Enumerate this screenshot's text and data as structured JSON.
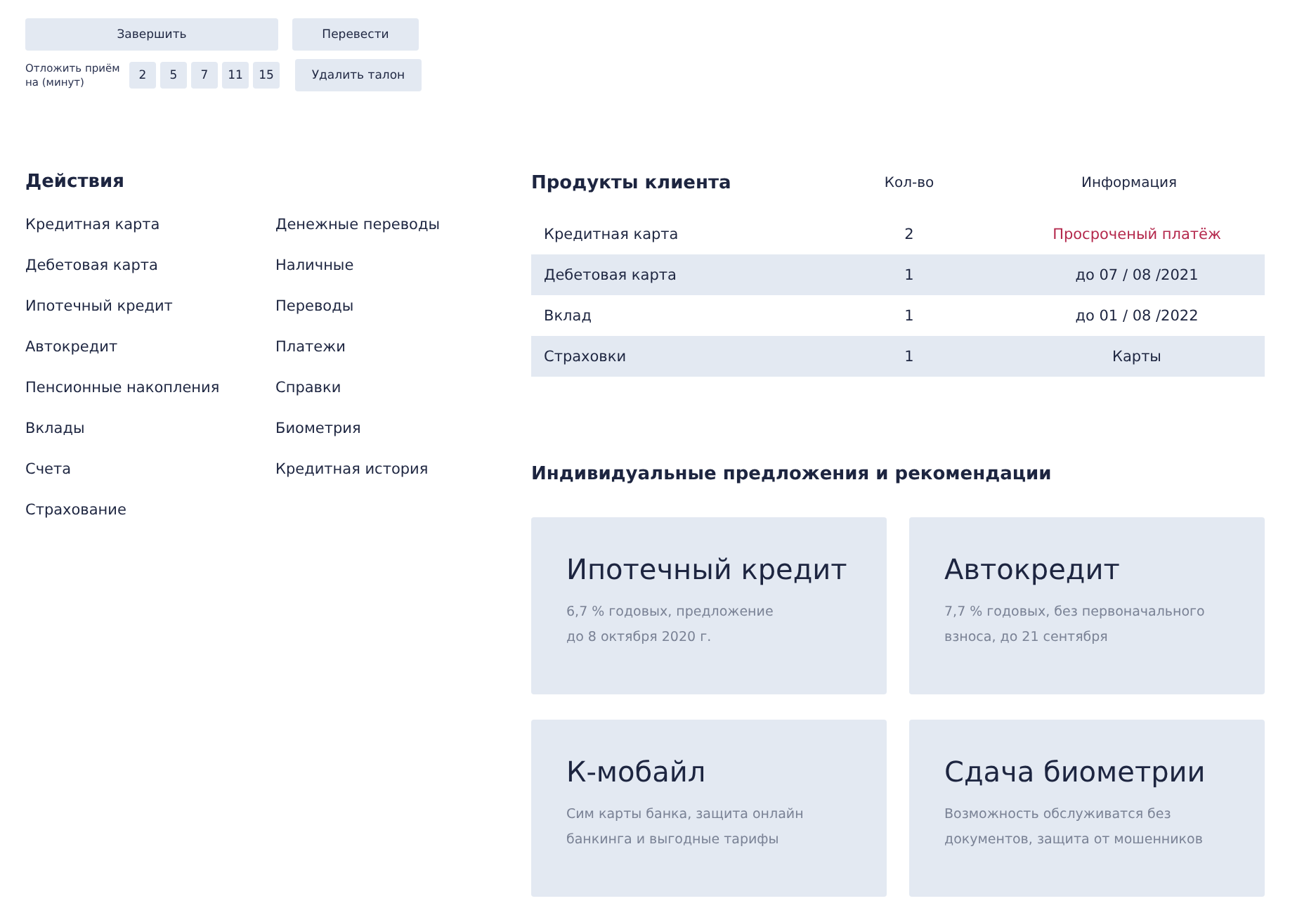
{
  "top_buttons": {
    "finish": "Завершить",
    "transfer": "Перевести",
    "delete": "Удалить талон"
  },
  "postpone": {
    "label": "Отложить приём на (минут)",
    "options": [
      "2",
      "5",
      "7",
      "11",
      "15"
    ]
  },
  "actions": {
    "title": "Действия",
    "columns": [
      [
        "Кредитная карта",
        "Дебетовая карта",
        "Ипотечный кредит",
        "Автокредит",
        "Пенсионные накопления",
        "Вклады",
        "Счета",
        "Страхование"
      ],
      [
        "Денежные переводы",
        "Наличные",
        "Переводы",
        "Платежи",
        "Справки",
        "Биометрия",
        "Кредитная история"
      ]
    ]
  },
  "products": {
    "title": "Продукты клиента",
    "columns": [
      "Кол-во",
      "Информация"
    ],
    "rows": [
      {
        "name": "Кредитная карта",
        "count": "2",
        "info": "Просроченый платёж",
        "alert": true
      },
      {
        "name": "Дебетовая карта",
        "count": "1",
        "info": "до 07 / 08 /2021",
        "alert": false
      },
      {
        "name": "Вклад",
        "count": "1",
        "info": "до 01 / 08 /2022",
        "alert": false
      },
      {
        "name": "Страховки",
        "count": "1",
        "info": "Карты",
        "alert": false
      }
    ]
  },
  "offers": {
    "title": "Индивидуальные предложения и рекомендации",
    "cards": [
      {
        "title": "Ипотечный кредит",
        "lines": [
          "6,7 % годовых, предложение",
          "до 8 октября 2020 г."
        ]
      },
      {
        "title": "Автокредит",
        "lines": [
          "7,7 % годовых, без первоначального",
          "взноса, до 21 сентября"
        ]
      },
      {
        "title": "К-мобайл",
        "lines": [
          "Сим карты банка, защита онлайн",
          "банкинга и выгодные тарифы"
        ]
      },
      {
        "title": "Сдача биометрии",
        "lines": [
          "Возможность обслуживатся без",
          "документов, защита от мошенников"
        ]
      }
    ]
  }
}
